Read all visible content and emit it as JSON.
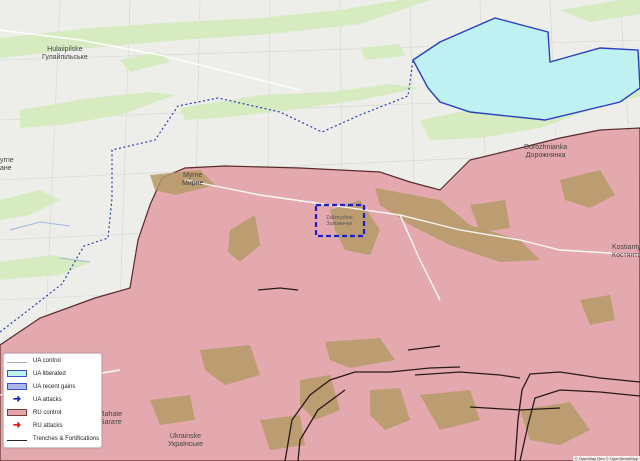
{
  "places": [
    {
      "id": "hulaipolske",
      "name": "Hulaiipilske",
      "name_local": "Гуляйпільське"
    },
    {
      "id": "myrne",
      "name": "Myrne",
      "name_local": "Мирне"
    },
    {
      "id": "dorozhnianka",
      "name": "Dorozhnianka",
      "name_local": "Дорожнянка"
    },
    {
      "id": "zaliznychne",
      "name": "Zaliznychne",
      "name_local": "Залізничне"
    },
    {
      "id": "kostiantynivka",
      "name": "Kostianty",
      "name_local": "Костянти"
    },
    {
      "id": "bahate",
      "name": "Bahate",
      "name_local": "Багате"
    },
    {
      "id": "ukrainske",
      "name": "Ukrainske",
      "name_local": "Українське"
    },
    {
      "id": "edge_left",
      "name": "yrne",
      "name_local": "ане"
    }
  ],
  "legend": [
    {
      "label": "UA control",
      "style": "line-gray"
    },
    {
      "label": "UA liberated",
      "style": "fill-cyan"
    },
    {
      "label": "UA recent gains",
      "style": "fill-blue"
    },
    {
      "label": "UA attacks",
      "style": "arrow-blue"
    },
    {
      "label": "RU control",
      "style": "fill-pink"
    },
    {
      "label": "RU attacks",
      "style": "arrow-red"
    },
    {
      "label": "Trenches & Fortifications",
      "style": "line-black"
    }
  ],
  "attribution": "© OpenMapTiles © OpenStreetMap",
  "colors": {
    "background": "#ededea",
    "ua_liberated": "#bff0f2",
    "ua_border": "#2a3fbf",
    "ru_control": "#e3a5ac",
    "ru_border": "#5a2b2b",
    "vegetation": "#d6ecc0",
    "terrain_brown": "#b59a66",
    "highlight_box": "#1b22c7"
  }
}
